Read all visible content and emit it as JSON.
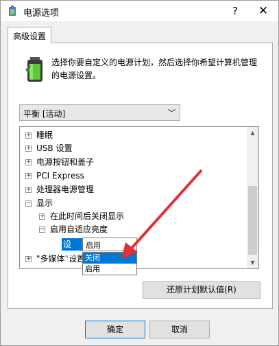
{
  "window": {
    "title": "电源选项",
    "help_glyph": "?",
    "close_glyph": "✕",
    "title_icon": "power-options-icon"
  },
  "tab": {
    "label": "高级设置"
  },
  "description": {
    "icon": "battery-icon",
    "line1": "选择你要自定义的电源计划，然后选择你希望计算机管理",
    "line2": "的电源设置。"
  },
  "plan_select": {
    "value": "平衡 [活动]"
  },
  "tree": {
    "items": [
      {
        "label": "睡眠",
        "expander": "+"
      },
      {
        "label": "USB 设置",
        "expander": "+"
      },
      {
        "label": "电源按钮和盖子",
        "expander": "+"
      },
      {
        "label": "PCI Express",
        "expander": "+"
      },
      {
        "label": "处理器电源管理",
        "expander": "+"
      },
      {
        "label": "显示",
        "expander": "−"
      },
      {
        "label": "在此时间后关闭显示",
        "expander": "+"
      },
      {
        "label": "启用自适应亮度",
        "expander": "−"
      },
      {
        "label": "\"多媒体\"设置",
        "expander": "+"
      }
    ],
    "setting_label": "设置:",
    "setting_value": "启用",
    "dropdown_options": [
      "关闭",
      "启用"
    ],
    "selected_option": "关闭"
  },
  "buttons": {
    "restore": "还原计划默认值(R)",
    "ok": "确定",
    "cancel": "取消"
  },
  "colors": {
    "accent": "#0078d7",
    "arrow": "#e0303a"
  }
}
